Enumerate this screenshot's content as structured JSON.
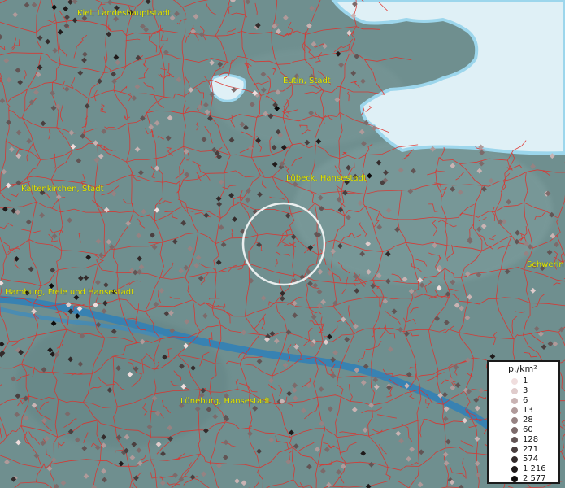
{
  "map": {
    "cities": [
      {
        "name": "Kiel, Landeshauptstadt"
      },
      {
        "name": "Eutin, Stadt"
      },
      {
        "name": "Kaltenkirchen, Stadt"
      },
      {
        "name": "Lübeck, Hansestadt"
      },
      {
        "name": "Hamburg, Freie und Hansestadt"
      },
      {
        "name": "Schwerin"
      },
      {
        "name": "Lüneburg, Hansestadt"
      }
    ],
    "legend": {
      "title": "p./km²",
      "levels": [
        {
          "value": "1",
          "color": "#f0dede"
        },
        {
          "value": "3",
          "color": "#e0cccc"
        },
        {
          "value": "6",
          "color": "#c9b3b3"
        },
        {
          "value": "13",
          "color": "#b09a9a"
        },
        {
          "value": "28",
          "color": "#968282"
        },
        {
          "value": "60",
          "color": "#7c6a6a"
        },
        {
          "value": "128",
          "color": "#625454"
        },
        {
          "value": "271",
          "color": "#4a3f3f"
        },
        {
          "value": "574",
          "color": "#332b2b"
        },
        {
          "value": "1 216",
          "color": "#1f1a1a"
        },
        {
          "value": "2 577",
          "color": "#0d0b0b"
        }
      ]
    },
    "colors": {
      "land": "#6f8f8f",
      "water": "#dff0f6",
      "river": "#2f80b8",
      "border": "#e0302a",
      "label": "#e8e800"
    }
  }
}
